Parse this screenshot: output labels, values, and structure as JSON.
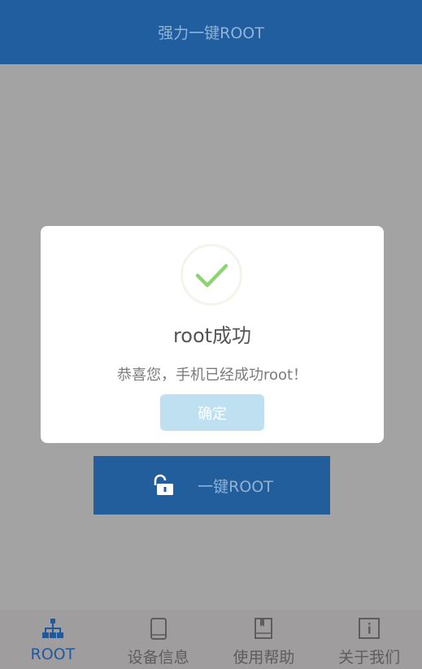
{
  "header": {
    "title": "强力一键ROOT"
  },
  "main": {
    "root_button_label": "一键ROOT",
    "root_button_icon": "unlock-icon"
  },
  "dialog": {
    "icon": "check-circle-icon",
    "title": "root成功",
    "message": "恭喜您，手机已经成功root！",
    "confirm_label": "确定"
  },
  "tabs": [
    {
      "label": "ROOT",
      "icon": "network-icon",
      "active": true
    },
    {
      "label": "设备信息",
      "icon": "phone-icon",
      "active": false
    },
    {
      "label": "使用帮助",
      "icon": "book-icon",
      "active": false
    },
    {
      "label": "关于我们",
      "icon": "info-icon",
      "active": false
    }
  ],
  "colors": {
    "header_bg": "#215ea0",
    "overlay_bg": "#a3a3a3",
    "button_bg": "#225e9c",
    "tab_active": "#22599d",
    "check_green": "#8dd36f",
    "confirm_bg": "#bfe0f1"
  }
}
